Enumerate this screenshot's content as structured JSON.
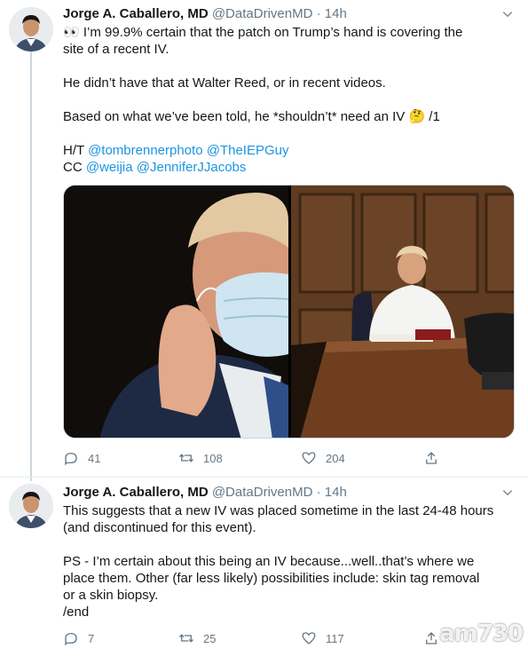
{
  "tweets": [
    {
      "author": {
        "name": "Jorge A. Caballero, MD",
        "handle": "@DataDrivenMD",
        "dot": "·",
        "time": "14h"
      },
      "lines": {
        "l1_emoji": "👀",
        "l1": " I’m 99.9% certain that the patch on Trump’s hand is covering the",
        "l2": "site of a recent IV.",
        "l3": "He didn’t have that at Walter Reed, or in recent videos.",
        "l4": "Based on what we’ve been told, he *shouldn’t* need an IV ",
        "l4_emoji": "🤔",
        "l4_end": " /1",
        "l5_prefix": "H/T ",
        "l5_link1": "@tombrennerphoto",
        "l5_link2": "@TheIEPGuy",
        "l6_prefix": " CC ",
        "l6_link1": "@weijia",
        "l6_link2": "@JenniferJJacobs"
      },
      "stats": {
        "replies": "41",
        "retweets": "108",
        "likes": "204"
      }
    },
    {
      "author": {
        "name": "Jorge A. Caballero, MD",
        "handle": "@DataDrivenMD",
        "dot": "·",
        "time": "14h"
      },
      "lines": {
        "l1": "This suggests that a new IV was placed sometime in the last 24-48 hours",
        "l2": "(and discontinued for this event).",
        "l3": "PS - I’m certain about this being an IV because...well..that’s where we",
        "l4": "place them. Other (far less likely) possibilities include: skin tag removal",
        "l5": "or a skin biopsy.",
        "l6": "/end"
      },
      "stats": {
        "replies": "7",
        "retweets": "25",
        "likes": "117"
      }
    }
  ],
  "watermark": "am730",
  "icons": {
    "reply": "reply-icon",
    "retweet": "retweet-icon",
    "like": "heart-icon",
    "share": "share-icon",
    "caret": "chevron-down-icon"
  },
  "colors": {
    "link": "#1b95e0",
    "secondary": "#657786",
    "border": "#e6ecf0"
  }
}
